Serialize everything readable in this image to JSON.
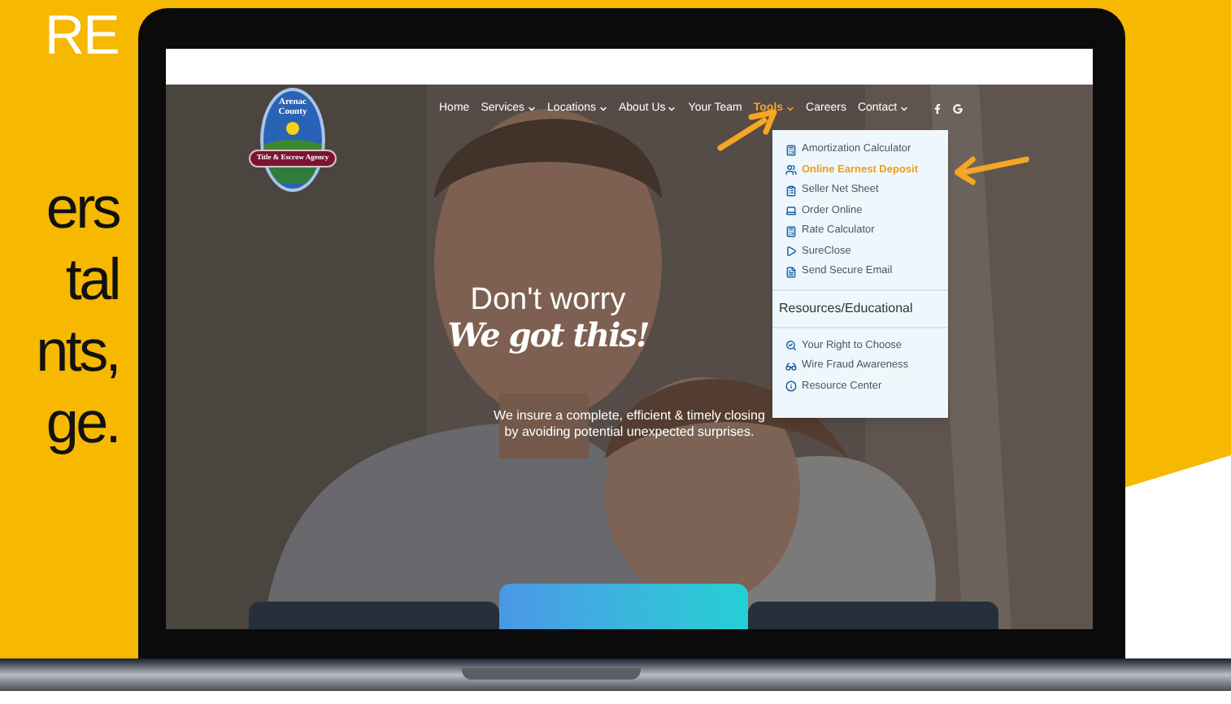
{
  "promo": {
    "heading": "RE",
    "lines": [
      "ers",
      "tal",
      "nts,",
      "ge."
    ]
  },
  "site": {
    "logo": {
      "top": [
        "Arenac",
        "County"
      ],
      "banner": "Title & Escrow Agency"
    },
    "nav": [
      {
        "label": "Home",
        "has_menu": false,
        "selected": false
      },
      {
        "label": "Services",
        "has_menu": true,
        "selected": false
      },
      {
        "label": "Locations",
        "has_menu": true,
        "selected": false
      },
      {
        "label": "About Us",
        "has_menu": true,
        "selected": false
      },
      {
        "label": "Your Team",
        "has_menu": false,
        "selected": false
      },
      {
        "label": "Tools",
        "has_menu": true,
        "selected": true
      },
      {
        "label": "Careers",
        "has_menu": false,
        "selected": false
      },
      {
        "label": "Contact",
        "has_menu": true,
        "selected": false
      }
    ],
    "dropdown": {
      "tools": [
        {
          "label": "Amortization Calculator",
          "selected": false
        },
        {
          "label": "Online Earnest Deposit",
          "selected": true
        },
        {
          "label": "Seller Net Sheet",
          "selected": false
        },
        {
          "label": "Order Online",
          "selected": false
        },
        {
          "label": "Rate Calculator",
          "selected": false
        },
        {
          "label": "SureClose",
          "selected": false
        },
        {
          "label": "Send Secure Email",
          "selected": false
        }
      ],
      "section": "Resources/Educational",
      "resources": [
        {
          "label": "Your Right to Choose",
          "selected": false
        },
        {
          "label": "Wire Fraud Awareness",
          "selected": false
        },
        {
          "label": "Resource Center",
          "selected": false
        }
      ]
    },
    "hero": {
      "title": "Don't worry",
      "script": "We got this!",
      "tagline": [
        "We insure a complete, efficient & timely closing",
        "by avoiding potential unexpected surprises."
      ]
    }
  }
}
